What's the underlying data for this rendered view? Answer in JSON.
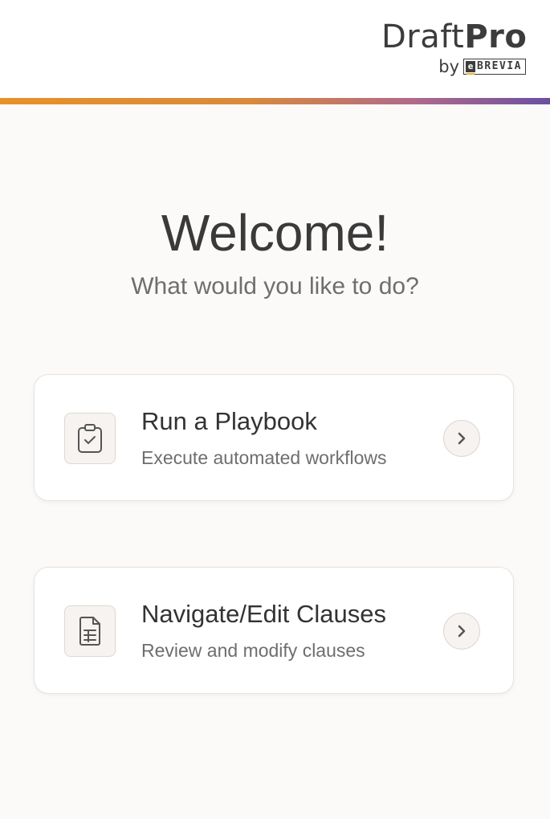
{
  "header": {
    "logo_light": "Draft",
    "logo_bold": "Pro",
    "logo_by": "by",
    "brand_e": "e",
    "brand_name": "BREVIA"
  },
  "main": {
    "title": "Welcome!",
    "subtitle": "What would you like to do?",
    "cards": [
      {
        "title": "Run a Playbook",
        "description": "Execute automated workflows",
        "icon": "clipboard-check-icon",
        "action_icon": "chevron-right-icon"
      },
      {
        "title": "Navigate/Edit Clauses",
        "description": "Review and modify clauses",
        "icon": "document-icon",
        "action_icon": "chevron-right-icon"
      }
    ]
  },
  "colors": {
    "background": "#fbfaf9",
    "accent_start": "#e8912a",
    "accent_end": "#6b4fa0",
    "text_primary": "#3a3a3a",
    "text_secondary": "#6e6e6e"
  }
}
